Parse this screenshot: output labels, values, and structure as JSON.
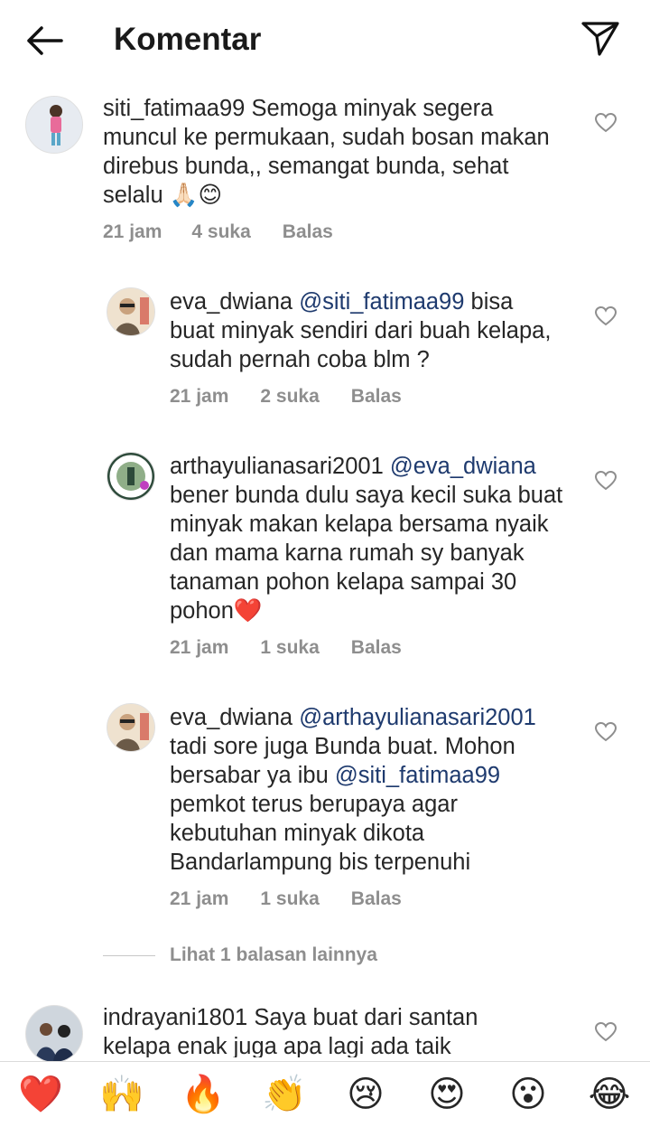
{
  "header": {
    "title": "Komentar"
  },
  "comments": [
    {
      "username": "siti_fatimaa99",
      "mention": "",
      "text": "Semoga minyak segera muncul ke permukaan, sudah bosan makan direbus bunda,, semangat bunda, sehat selalu 🙏🏻😊",
      "time": "21 jam",
      "likes": "4 suka",
      "reply": "Balas"
    },
    {
      "username": "eva_dwiana",
      "mention": "@siti_fatimaa99",
      "text": "bisa buat minyak sendiri dari buah kelapa, sudah pernah coba blm ?",
      "time": "21 jam",
      "likes": "2 suka",
      "reply": "Balas"
    },
    {
      "username": "arthayulianasari2001",
      "mention": "@eva_dwiana",
      "text": "bener bunda dulu saya kecil suka buat minyak makan kelapa bersama nyaik dan mama karna rumah sy banyak tanaman pohon kelapa sampai 30 pohon❤️",
      "time": "21 jam",
      "likes": "1 suka",
      "reply": "Balas"
    },
    {
      "username": "eva_dwiana",
      "mention": "@arthayulianasari2001",
      "text_a": "tadi sore juga Bunda buat. Mohon bersabar ya ibu",
      "mention2": "@siti_fatimaa99",
      "text_b": "pemkot terus berupaya agar kebutuhan minyak dikota Bandarlampung bis terpenuhi",
      "time": "21 jam",
      "likes": "1 suka",
      "reply": "Balas"
    },
    {
      "username": "indrayani1801",
      "mention": "",
      "text": "Saya buat dari santan kelapa enak juga apa lagi ada taik"
    }
  ],
  "more_replies": "Lihat 1 balasan lainnya",
  "emoji_bar": [
    "❤️",
    "🙌",
    "🔥",
    "👏",
    "😢",
    "😍",
    "😮",
    "😂"
  ]
}
